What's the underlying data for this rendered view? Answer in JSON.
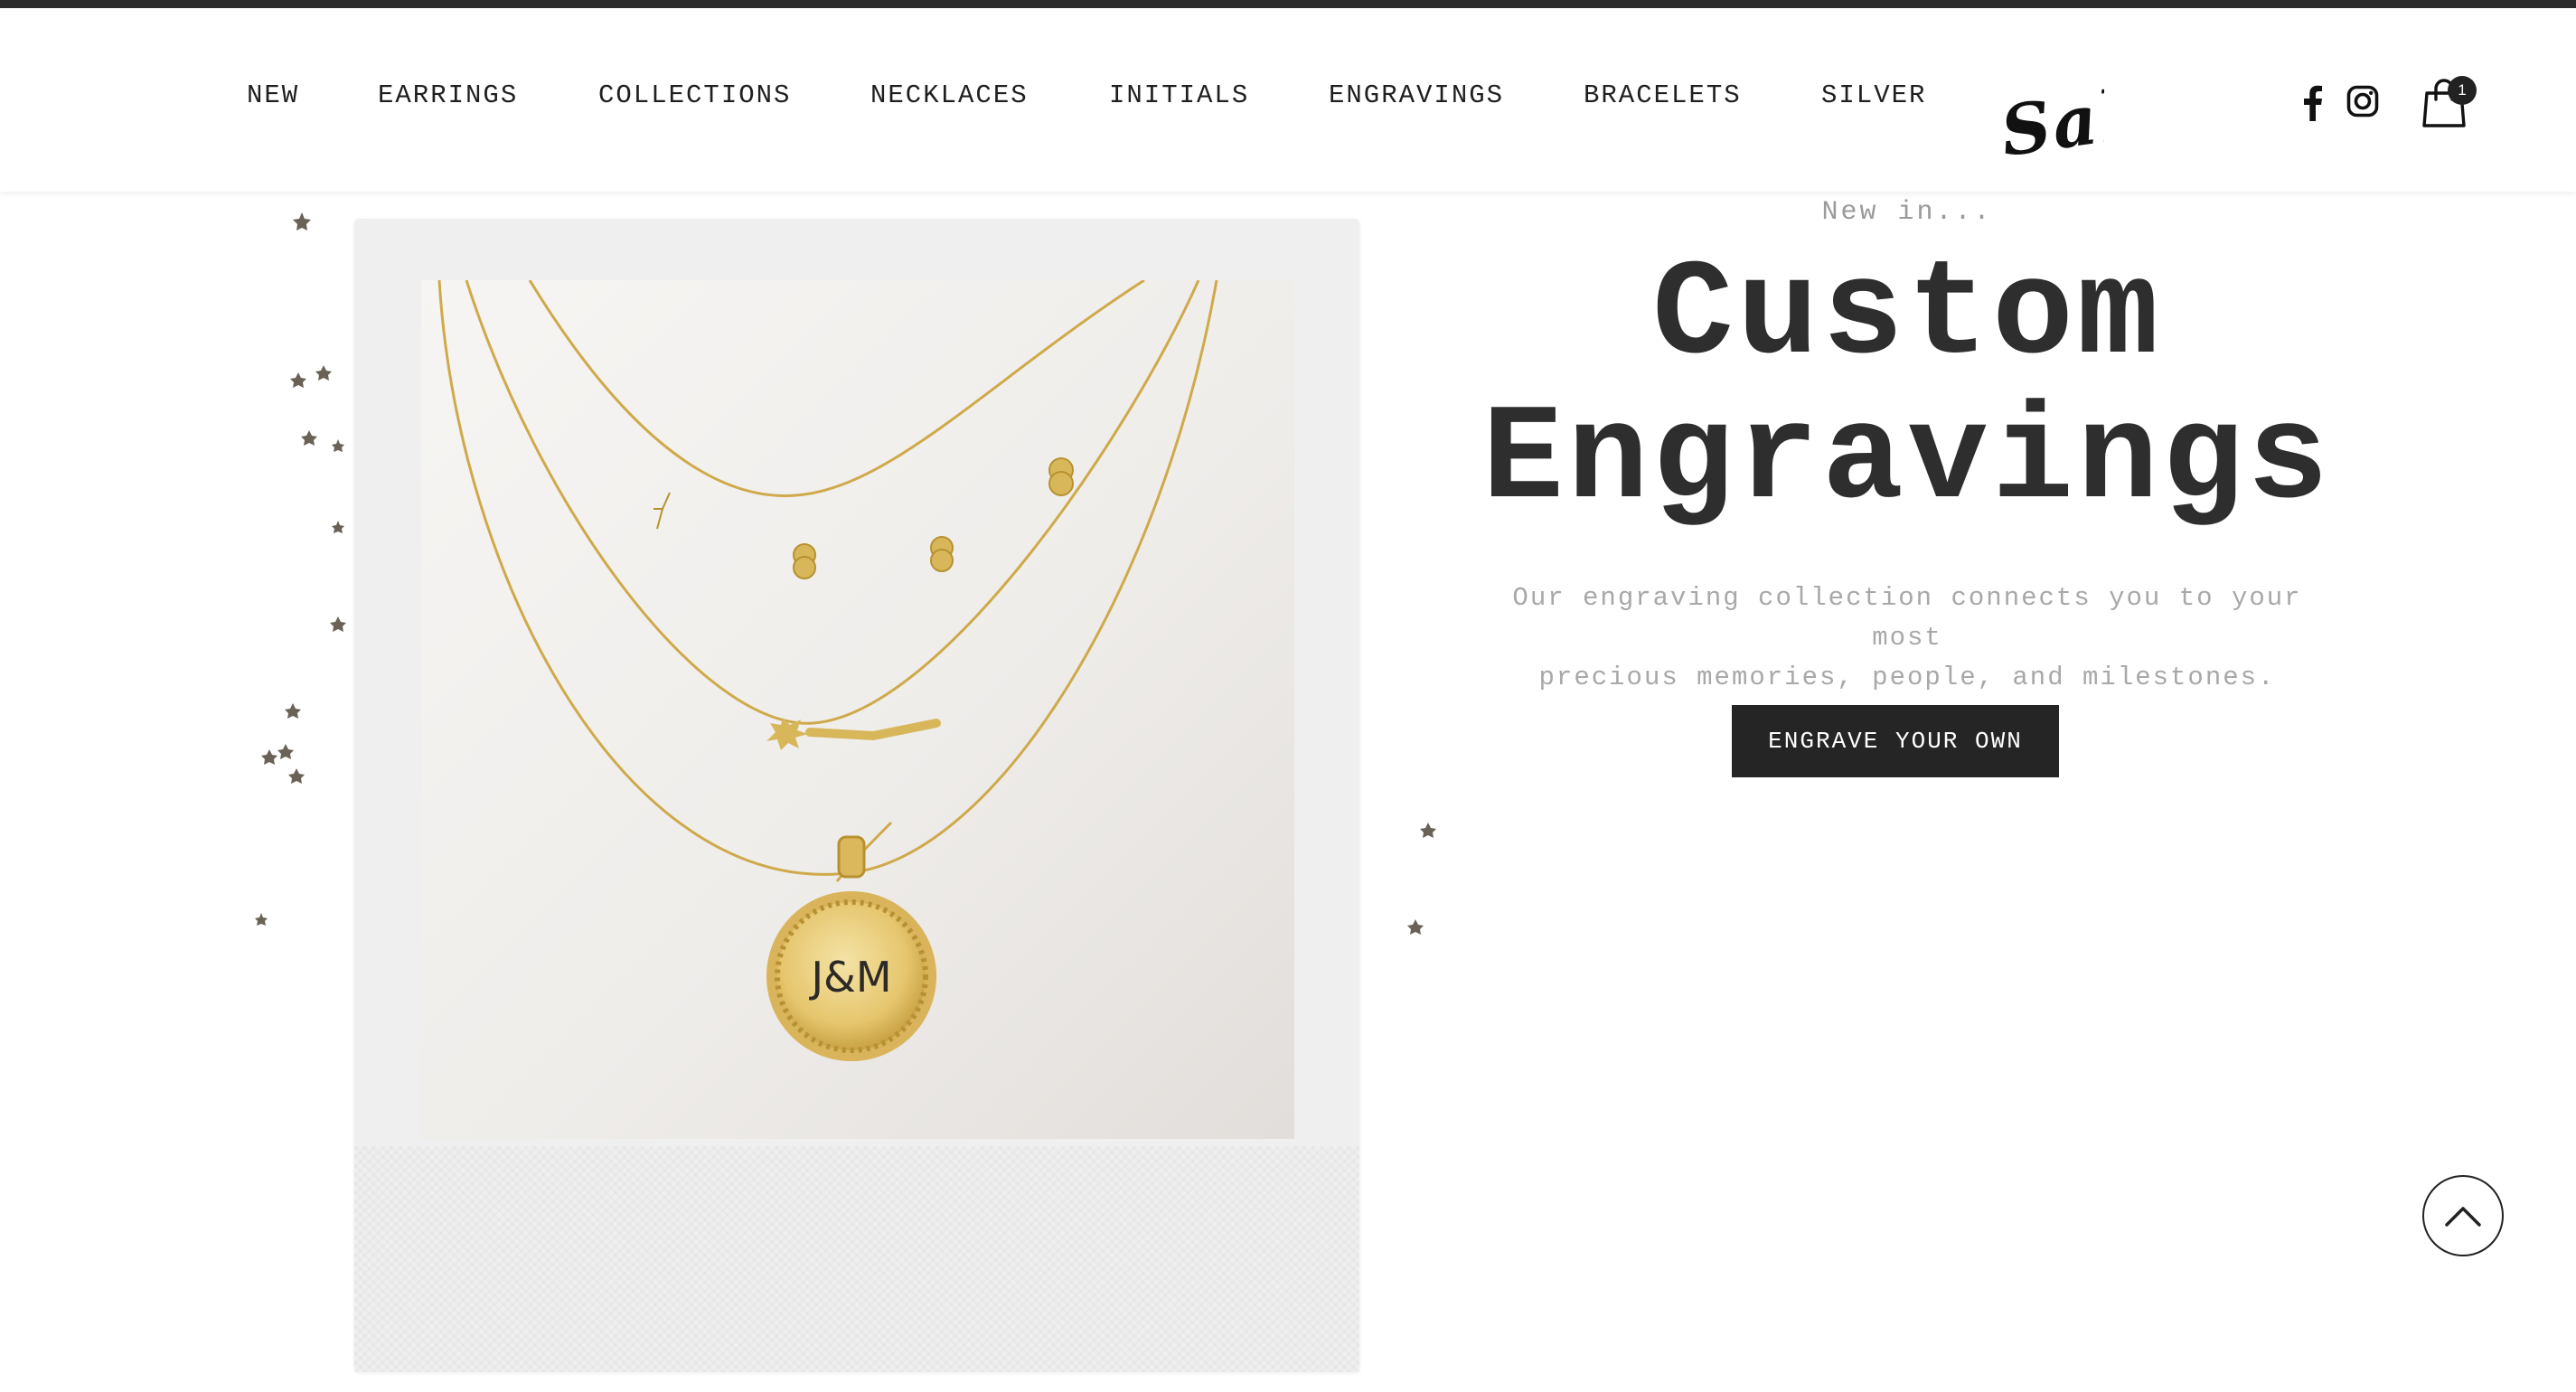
{
  "nav": {
    "items": [
      {
        "label": "NEW"
      },
      {
        "label": "EARRINGS"
      },
      {
        "label": "COLLECTIONS"
      },
      {
        "label": "NECKLACES"
      },
      {
        "label": "INITIALS"
      },
      {
        "label": "ENGRAVINGS"
      },
      {
        "label": "BRACELETS"
      },
      {
        "label": "SILVER"
      }
    ],
    "sale_label": "Sale"
  },
  "header_icons": {
    "facebook": "facebook-icon",
    "instagram": "instagram-icon",
    "cart": "shopping-bag-icon",
    "cart_count": "1"
  },
  "hero": {
    "eyebrow": "New in...",
    "title_line1": "Custom",
    "title_line2": "Engravings",
    "description_line1": "Our engraving collection connects you to your most",
    "description_line2": "precious memories, people, and milestones.",
    "cta_label": "ENGRAVE YOUR OWN",
    "pendant_text": "J&M"
  },
  "colors": {
    "accent": "#252525",
    "gold": "#d4af37",
    "muted_text": "#a8a8a8"
  },
  "scroll_top_icon": "chevron-up-icon"
}
